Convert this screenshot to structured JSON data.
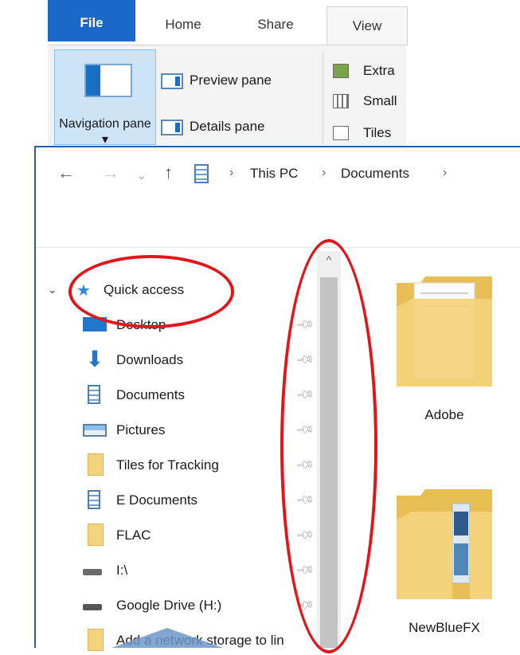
{
  "ribbon": {
    "tabs": [
      "File",
      "Home",
      "Share",
      "View"
    ],
    "navigation_pane": "Navigation pane ▾",
    "preview_pane": "Preview pane",
    "details_pane": "Details pane",
    "layouts": [
      "Extra",
      "Small",
      "Tiles"
    ]
  },
  "address": {
    "this_pc": "This PC",
    "documents": "Documents",
    "sep": "›"
  },
  "nav": {
    "quick_access": "Quick access",
    "items": [
      {
        "label": "Desktop",
        "icon": "desktop-icon"
      },
      {
        "label": "Downloads",
        "icon": "downloads-icon"
      },
      {
        "label": "Documents",
        "icon": "documents-icon"
      },
      {
        "label": "Pictures",
        "icon": "pictures-icon"
      },
      {
        "label": "Tiles for Tracking",
        "icon": "folder-icon"
      },
      {
        "label": "E Documents",
        "icon": "documents-icon"
      },
      {
        "label": "FLAC",
        "icon": "folder-icon"
      },
      {
        "label": "I:\\",
        "icon": "drive-icon"
      },
      {
        "label": "Google Drive (H:)",
        "icon": "drive-icon"
      },
      {
        "label": "Add a network storage to lin",
        "icon": "folder-icon"
      }
    ]
  },
  "content": {
    "folders": [
      "Adobe",
      "NewBlueFX"
    ]
  },
  "colors": {
    "accent": "#1a68c7",
    "annotation": "#e0161b",
    "folder": "#f3d37b"
  }
}
